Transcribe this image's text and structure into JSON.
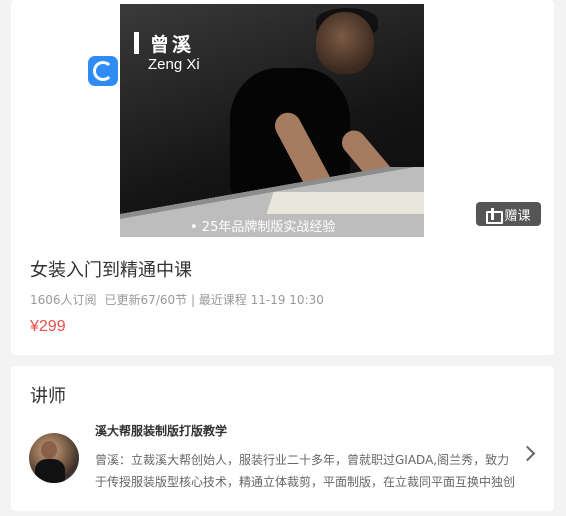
{
  "cover": {
    "name_cn": "曾溪",
    "name_en": "Zeng Xi",
    "tagline": "• 25年品牌制版实战经验"
  },
  "gift_button": {
    "label": "赠课",
    "icon": "gift-icon"
  },
  "course": {
    "title": "女装入门到精通中课",
    "subscribers": "1606人订阅",
    "update_info": "已更新67/60节 | 最近课程 11-19 10:30",
    "price": "¥299"
  },
  "teacher": {
    "heading": "讲师",
    "name": "溪大帮服装制版打版教学",
    "description": "曾溪：立裁溪大帮创始人，服装行业二十多年，曾就职过GIADA,阁兰秀，致力于传授服装版型核心技术，精通立体裁剪，平面制版，在立裁同平面互换中独创"
  },
  "colors": {
    "price": "#e8504a",
    "gift_button_bg": "#555555",
    "logo_blue": "#2f8cf5"
  }
}
